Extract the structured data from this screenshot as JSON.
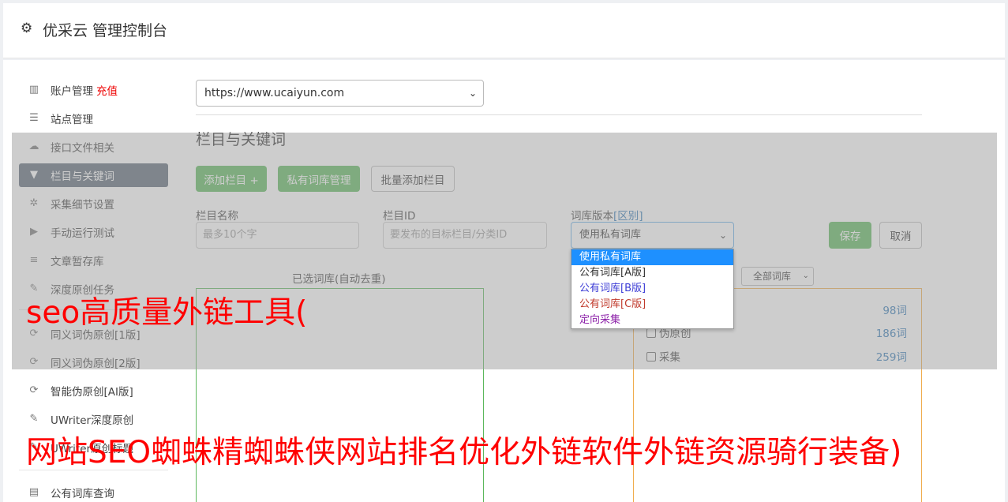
{
  "header": {
    "title": "优采云 管理控制台",
    "icon": "gear-icon"
  },
  "sidebar": {
    "items": [
      {
        "label": "账户管理",
        "extra": "充值",
        "icon": "bar-chart-icon"
      },
      {
        "label": "站点管理",
        "icon": "server-icon"
      },
      {
        "label": "接口文件相关",
        "icon": "cloud-upload-icon"
      },
      {
        "label": "栏目与关键词",
        "icon": "filter-icon",
        "active": true
      },
      {
        "label": "采集细节设置",
        "icon": "cogs-icon"
      },
      {
        "label": "手动运行测试",
        "icon": "play-icon"
      },
      {
        "label": "文章暂存库",
        "icon": "database-icon"
      },
      {
        "label": "深度原创任务",
        "icon": "edit-icon"
      },
      {
        "label": "同义词伪原创[1版]",
        "icon": "refresh-icon"
      },
      {
        "label": "同义词伪原创[2版]",
        "icon": "refresh-icon"
      },
      {
        "label": "智能伪原创[AI版]",
        "icon": "refresh-icon"
      },
      {
        "label": "UWriter深度原创",
        "icon": "edit-icon"
      },
      {
        "label": "UWriter原创标题",
        "icon": "edit-icon"
      },
      {
        "label": "公有词库查询",
        "icon": "book-icon"
      }
    ]
  },
  "main": {
    "site_select": "https://www.ucaiyun.com",
    "section_title": "栏目与关键词",
    "buttons": {
      "add_column": "添加栏目 +",
      "private_lib": "私有词库管理",
      "batch_add": "批量添加栏目"
    },
    "form": {
      "name_label": "栏目名称",
      "name_placeholder": "最多10个字",
      "id_label": "栏目ID",
      "id_placeholder": "要发布的目标栏目/分类ID",
      "version_label": "词库版本",
      "version_link": "[区别]",
      "version_value": "使用私有词库",
      "save": "保存",
      "cancel": "取消"
    },
    "dropdown_options": [
      "使用私有词库",
      "公有词库[A版]",
      "公有词库[B版]",
      "公有词库[C版]",
      "定向采集"
    ],
    "selected_box_title": "已选词库(自动去重)",
    "lib_filter": "全部词库",
    "libs": [
      {
        "name": "",
        "count": "98词"
      },
      {
        "name": "伪原创",
        "count": "186词"
      },
      {
        "name": "采集",
        "count": "259词"
      }
    ]
  },
  "overlay": {
    "line1": "seo高质量外链工具(",
    "line2": "网站SEO蜘蛛精蜘蛛侠网站排名优化外链软件外链资源骑行装备)"
  },
  "colors": {
    "green": "#5cb85c",
    "orange": "#f0ad4e",
    "active_bg": "#5d6a78",
    "overlay_text": "#ff0000"
  }
}
